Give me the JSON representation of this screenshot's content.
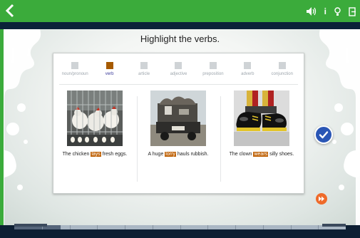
{
  "app": {
    "title": "Highlight the verbs.",
    "colors": {
      "topbar": "#3bab3b",
      "highlight": "#c0640a",
      "check": "#2a56b5",
      "next": "#ef6a2a"
    },
    "top_icons": [
      "back-icon",
      "volume-icon",
      "info-icon",
      "hint-icon",
      "exit-icon"
    ],
    "info_glyph": "i"
  },
  "parts_of_speech": [
    {
      "label": "noun/pronoun"
    },
    {
      "label": "verb",
      "selected": true
    },
    {
      "label": "article"
    },
    {
      "label": "adjective"
    },
    {
      "label": "preposition"
    },
    {
      "label": "adverb"
    },
    {
      "label": "conjunction"
    }
  ],
  "items": [
    {
      "image": "chickens-in-cage",
      "words": [
        "The",
        "chicken",
        "lays",
        "fresh",
        "eggs."
      ],
      "highlighted": [
        "lays"
      ]
    },
    {
      "image": "truck-with-rubbish",
      "words": [
        "A",
        "huge",
        "lorry",
        "hauls",
        "rubbish."
      ],
      "highlighted": [
        "lorry"
      ]
    },
    {
      "image": "clown-shoes",
      "words": [
        "The",
        "clown",
        "wears",
        "silly",
        "shoes."
      ],
      "highlighted": [
        "wears"
      ]
    }
  ],
  "progress": {
    "value": 0.14,
    "segments": 12
  }
}
